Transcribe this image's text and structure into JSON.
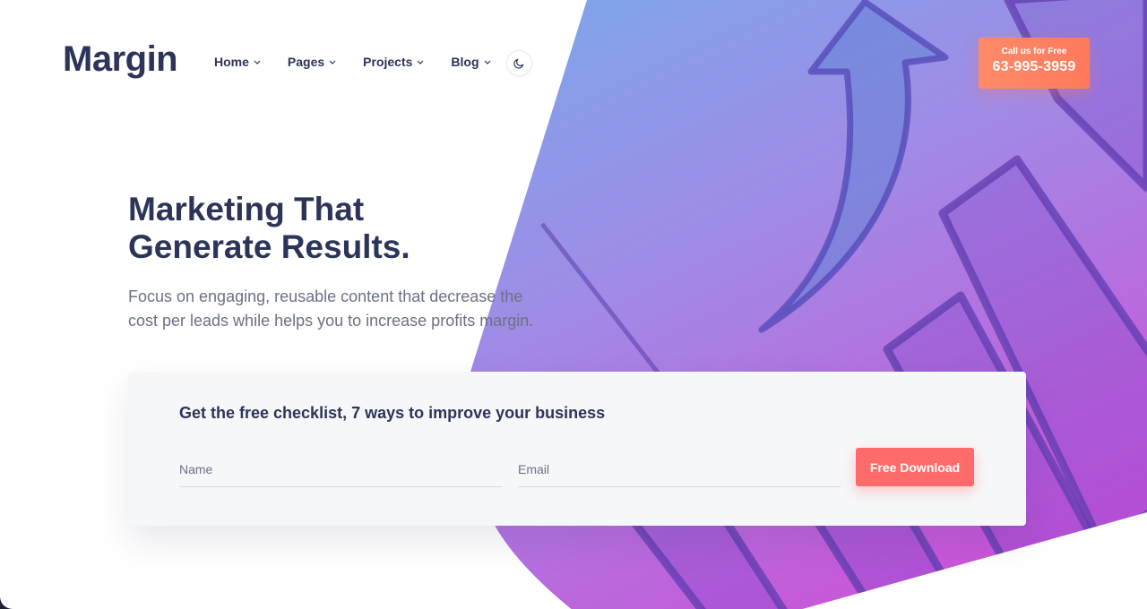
{
  "brand": {
    "name": "Margin"
  },
  "nav": {
    "items": [
      {
        "label": "Home"
      },
      {
        "label": "Pages"
      },
      {
        "label": "Projects"
      },
      {
        "label": "Blog"
      }
    ]
  },
  "header": {
    "theme_toggle_icon": "moon-icon",
    "call": {
      "label": "Call us for Free",
      "phone": "63-995-3959"
    }
  },
  "hero": {
    "headline_line1": "Marketing That",
    "headline_line2": "Generate Results.",
    "subtext": "Focus on engaging, reusable content that decrease the cost per leads while helps you to increase profits margin."
  },
  "form": {
    "title": "Get the free checklist, 7 ways to improve your business",
    "name_placeholder": "Name",
    "email_placeholder": "Email",
    "submit_label": "Free Download"
  },
  "colors": {
    "brand_text": "#2d3459",
    "call_button": "#ff7f60",
    "download_button": "#ff6b6b",
    "hero_gradient_start": "#7aa6ec",
    "hero_gradient_end": "#c84fd8"
  }
}
